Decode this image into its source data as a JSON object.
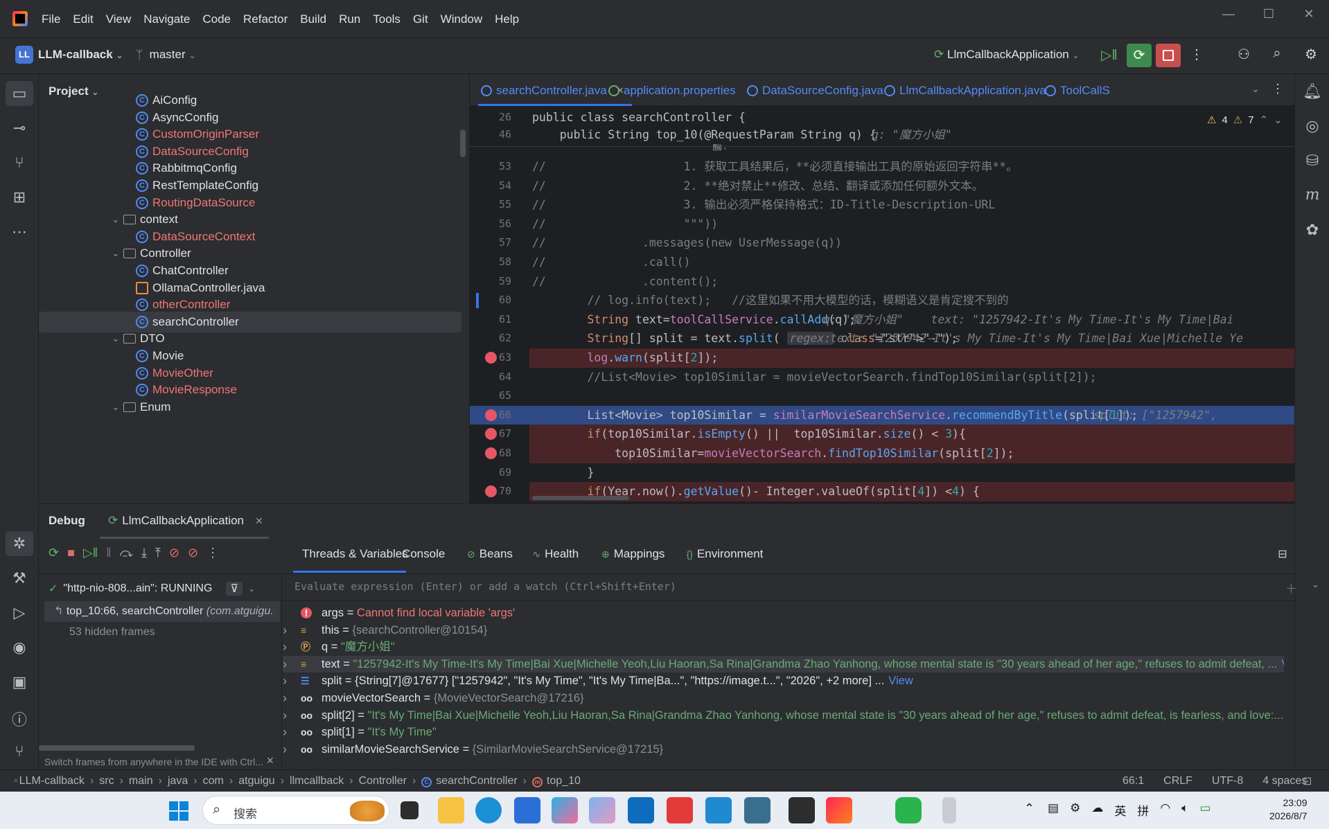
{
  "menu": [
    "File",
    "Edit",
    "View",
    "Navigate",
    "Code",
    "Refactor",
    "Build",
    "Run",
    "Tools",
    "Git",
    "Window",
    "Help"
  ],
  "toolbar": {
    "project_badge": "LL",
    "project_name": "LLM-callback",
    "branch": "master",
    "run_config": "LlmCallbackApplication"
  },
  "project_panel": {
    "title": "Project",
    "items": [
      {
        "label": "AiConfig",
        "type": "class",
        "level": 3,
        "error": false
      },
      {
        "label": "AsyncConfig",
        "type": "class",
        "level": 3,
        "error": false
      },
      {
        "label": "CustomOriginParser",
        "type": "class",
        "level": 3,
        "error": true
      },
      {
        "label": "DataSourceConfig",
        "type": "class",
        "level": 3,
        "error": true
      },
      {
        "label": "RabbitmqConfig",
        "type": "class",
        "level": 3,
        "error": false
      },
      {
        "label": "RestTemplateConfig",
        "type": "class",
        "level": 3,
        "error": false
      },
      {
        "label": "RoutingDataSource",
        "type": "class",
        "level": 3,
        "error": true
      },
      {
        "label": "context",
        "type": "folder",
        "level": 2,
        "error": false
      },
      {
        "label": "DataSourceContext",
        "type": "class",
        "level": 3,
        "error": true
      },
      {
        "label": "Controller",
        "type": "folder",
        "level": 2,
        "error": false
      },
      {
        "label": "ChatController",
        "type": "class",
        "level": 3,
        "error": false
      },
      {
        "label": "OllamaController.java",
        "type": "file",
        "level": 3,
        "error": false
      },
      {
        "label": "otherController",
        "type": "class",
        "level": 3,
        "error": true
      },
      {
        "label": "searchController",
        "type": "class",
        "level": 3,
        "error": false,
        "selected": true
      },
      {
        "label": "DTO",
        "type": "folder",
        "level": 2,
        "error": false
      },
      {
        "label": "Movie",
        "type": "class",
        "level": 3,
        "error": false
      },
      {
        "label": "MovieOther",
        "type": "class",
        "level": 3,
        "error": true
      },
      {
        "label": "MovieResponse",
        "type": "class",
        "level": 3,
        "error": true
      },
      {
        "label": "Enum",
        "type": "folder",
        "level": 2,
        "error": false
      }
    ]
  },
  "editor_tabs": [
    {
      "label": "searchController.java",
      "active": true
    },
    {
      "label": "application.properties",
      "active": false
    },
    {
      "label": "DataSourceConfig.java",
      "active": false
    },
    {
      "label": "LlmCallbackApplication.java",
      "active": false
    },
    {
      "label": "ToolCallS",
      "active": false
    }
  ],
  "inspections": {
    "warnings": "4",
    "weak_warnings": "7"
  },
  "sticky": [
    {
      "ln": "26",
      "text": "public class searchController {"
    },
    {
      "ln": "46",
      "text": "    public String top_10(@RequestParam String q) {",
      "hint": "q: \"魔方小姐\""
    }
  ],
  "code": [
    {
      "ln": "53",
      "text": "//                    1. 获取工具结果后，**必须直接输出工具的原始返回字符串**。"
    },
    {
      "ln": "54",
      "text": "//                    2. **绝对禁止**修改、总结、翻译或添加任何额外文本。"
    },
    {
      "ln": "55",
      "text": "//                    3. 输出必须严格保持格式：ID-Title-Description-URL"
    },
    {
      "ln": "56",
      "text": "//                    \"\"\"))"
    },
    {
      "ln": "57",
      "text": "//              .messages(new UserMessage(q))"
    },
    {
      "ln": "58",
      "text": "//              .call()"
    },
    {
      "ln": "59",
      "text": "//              .content();"
    },
    {
      "ln": "60",
      "text": "        // log.info(text);   //这里如果不用大模型的话，模糊语义是肯定搜不到的"
    },
    {
      "ln": "61",
      "text": "        String text=toolCallService.callAdd(q);",
      "hint": "q: \"魔方小姐\"    text: \"1257942-It's My Time-It's My Time|Bai"
    },
    {
      "ln": "62",
      "text": "        String[] split = text.split( regex: \"-\");",
      "hint": "text: \"1257942-It's My Time-It's My Time|Bai Xue|Michelle Ye"
    },
    {
      "ln": "63",
      "text": "        log.warn(split[2]);",
      "bp": true
    },
    {
      "ln": "64",
      "text": "        //List<Movie> top10Similar = movieVectorSearch.findTop10Similar(split[2]);"
    },
    {
      "ln": "65",
      "text": ""
    },
    {
      "ln": "66",
      "text": "        List<Movie> top10Similar = similarMovieSearchService.recommendByTitle(split[1]);",
      "hint": "split: [\"1257942\",",
      "bp": true,
      "current": true
    },
    {
      "ln": "67",
      "text": "        if(top10Similar.isEmpty() ||  top10Similar.size() < 3){",
      "bp": true
    },
    {
      "ln": "68",
      "text": "            top10Similar=movieVectorSearch.findTop10Similar(split[2]);",
      "bp": true
    },
    {
      "ln": "69",
      "text": "        }"
    },
    {
      "ln": "70",
      "text": "        if(Year.now().getValue()- Integer.valueOf(split[4]) <4) {",
      "bp": true
    }
  ],
  "code_partial_top": "规则:",
  "debug": {
    "title": "Debug",
    "session": "LlmCallbackApplication",
    "tabs": [
      "Threads & Variables",
      "Console",
      "Beans",
      "Health",
      "Mappings",
      "Environment"
    ],
    "thread": "\"http-nio-808...ain\": RUNNING",
    "frame": "top_10:66, searchController",
    "frame_pkg": "(com.atguigu.",
    "hidden_frames": "53 hidden frames",
    "hint": "Switch frames from anywhere in the IDE with Ctrl...",
    "eval_placeholder": "Evaluate expression (Enter) or add a watch (Ctrl+Shift+Enter)",
    "variables": [
      {
        "name": "args",
        "eq": " = ",
        "value": "Cannot find local variable 'args'",
        "kind": "error"
      },
      {
        "name": "this",
        "eq": " = ",
        "value": "{searchController@10154}",
        "kind": "obj"
      },
      {
        "name": "q",
        "eq": " = ",
        "value": "\"魔方小姐\"",
        "kind": "param"
      },
      {
        "name": "text",
        "eq": " = ",
        "value": "\"1257942-It's My Time-It's My Time|Bai Xue|Michelle Yeoh,Liu Haoran,Sa Rina|Grandma Zhao Yanhong, whose mental state is \"30 years ahead of her age,\" refuses to admit defeat, ...",
        "link": "View",
        "kind": "str"
      },
      {
        "name": "split",
        "eq": " = ",
        "value": "{String[7]@17677} [\"1257942\", \"It's My Time\", \"It's My Time|Ba...\", \"https://image.t...\", \"2026\", +2 more] ...",
        "link": "View",
        "kind": "arr"
      },
      {
        "name": "movieVectorSearch",
        "eq": " = ",
        "value": "{MovieVectorSearch@17216}",
        "kind": "watch"
      },
      {
        "name": "split[2]",
        "eq": " = ",
        "value": "\"It's My Time|Bai Xue|Michelle Yeoh,Liu Haoran,Sa Rina|Grandma Zhao Yanhong, whose mental state is \"30 years ahead of her age,\" refuses to admit defeat, is fearless, and love:...",
        "link": "View",
        "kind": "watchstr"
      },
      {
        "name": "split[1]",
        "eq": " = ",
        "value": "\"It's My Time\"",
        "kind": "watchstr"
      },
      {
        "name": "similarMovieSearchService",
        "eq": " = ",
        "value": "{SimilarMovieSearchService@17215}",
        "kind": "watch"
      }
    ]
  },
  "breadcrumb": [
    "LLM-callback",
    "src",
    "main",
    "java",
    "com",
    "atguigu",
    "llmcallback",
    "Controller",
    "searchController",
    "top_10"
  ],
  "status": {
    "position": "66:1",
    "line_sep": "CRLF",
    "encoding": "UTF-8",
    "indent": "4 spaces"
  },
  "taskbar": {
    "search_placeholder": "搜索",
    "ime1": "英",
    "ime2": "拼",
    "time": "23:09",
    "date": "2026/8/7"
  }
}
